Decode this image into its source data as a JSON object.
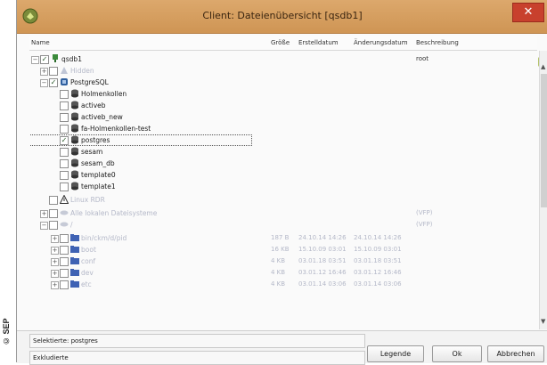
{
  "watermark": "© SEP",
  "window": {
    "title": "Client: Dateienübersicht [qsdb1]",
    "close_glyph": "✕"
  },
  "columns": [
    "Name",
    "Größe",
    "Erstelldatum",
    "Änderungsdatum",
    "Beschreibung"
  ],
  "tree": {
    "root": {
      "label": "qsdb1",
      "description": "root"
    },
    "item_hidden": "Hidden",
    "postgres_group": "PostgreSQL",
    "databases": [
      "Holmenkollen",
      "activeb",
      "activeb_new",
      "fa-Holmenkollen-test",
      "postgres",
      "sesam",
      "sesam_db",
      "template0",
      "template1"
    ],
    "selected_db": "postgres",
    "linux_item": "Linux RDR",
    "faded_group_1": {
      "label": "Alle lokalen Dateisysteme",
      "description": "(VFP)"
    },
    "faded_group_2": {
      "label": "/",
      "description": "(VFP)"
    },
    "file_rows": [
      {
        "name": "bin/ckm/d/pid",
        "size": "187 B",
        "created": "24.10.14 14:26",
        "modified": "24.10.14 14:26"
      },
      {
        "name": "boot",
        "size": "16 KB",
        "created": "15.10.09 03:01",
        "modified": "15.10.09 03:01"
      },
      {
        "name": "conf",
        "size": "4 KB",
        "created": "03.01.18 03:51",
        "modified": "03.01.18 03:51"
      },
      {
        "name": "dev",
        "size": "4 KB",
        "created": "03.01.12 16:46",
        "modified": "03.01.12 16:46"
      },
      {
        "name": "etc",
        "size": "4 KB",
        "created": "03.01.14 03:06",
        "modified": "03.01.14 03:06"
      }
    ]
  },
  "status": {
    "selected_label": "Selektierte: postgres",
    "excluded_label": "Exkludierte"
  },
  "buttons": {
    "legend": "Legende",
    "ok": "Ok",
    "cancel": "Abbrechen"
  }
}
